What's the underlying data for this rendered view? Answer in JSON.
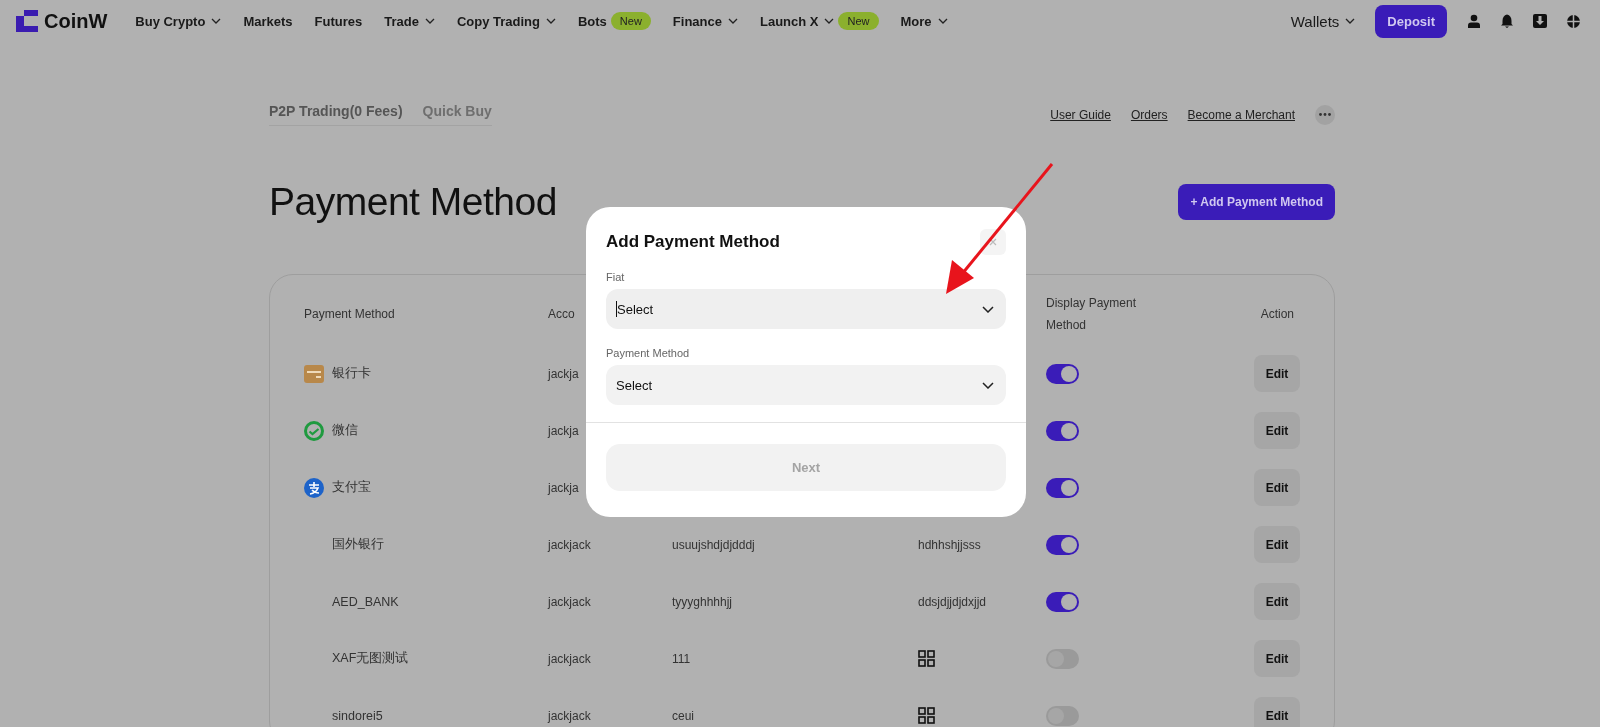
{
  "nav": {
    "logo": "CoinW",
    "items": [
      {
        "label": "Buy Crypto",
        "caret": true
      },
      {
        "label": "Markets",
        "caret": false
      },
      {
        "label": "Futures",
        "caret": false
      },
      {
        "label": "Trade",
        "caret": true
      },
      {
        "label": "Copy Trading",
        "caret": true
      },
      {
        "label": "Bots",
        "caret": false,
        "badge": "New"
      },
      {
        "label": "Finance",
        "caret": true
      },
      {
        "label": "Launch X",
        "caret": true,
        "badge": "New"
      },
      {
        "label": "More",
        "caret": true
      }
    ],
    "wallets": "Wallets",
    "deposit": "Deposit"
  },
  "subnav": {
    "tabs": [
      {
        "label": "P2P Trading(0 Fees)",
        "selected": true
      },
      {
        "label": "Quick Buy",
        "selected": false
      }
    ],
    "links": [
      "User Guide",
      "Orders",
      "Become a Merchant"
    ]
  },
  "page_title": "Payment Method",
  "add_button": "+ Add Payment Method",
  "table": {
    "columns": [
      "Payment Method",
      "Acco",
      "",
      "",
      "Display Payment Method",
      "Action"
    ],
    "rows": [
      {
        "method": "银行卡",
        "account": "jackja",
        "column_3": "",
        "column_4": {
          "kind": "hidden"
        },
        "on": true,
        "action": "Edit"
      },
      {
        "method": "微信",
        "account": "jackja",
        "column_3": "",
        "column_4": {
          "kind": "hidden"
        },
        "on": true,
        "action": "Edit"
      },
      {
        "method": "支付宝",
        "account": "jackja",
        "column_3": "",
        "column_4": {
          "kind": "hidden"
        },
        "on": true,
        "action": "Edit"
      },
      {
        "method": "国外银行",
        "account": "jackjack",
        "column_3": "usuujshdjdjdddj",
        "column_4": {
          "kind": "text",
          "text": "hdhhshjjsss"
        },
        "on": true,
        "action": "Edit"
      },
      {
        "method": "AED_BANK",
        "account": "jackjack",
        "column_3": "tyyyghhhhjj",
        "column_4": {
          "kind": "text",
          "text": "ddsjdjjdjdxjjd"
        },
        "on": true,
        "action": "Edit"
      },
      {
        "method": "XAF无图测试",
        "account": "jackjack",
        "column_3": "111",
        "column_4": {
          "kind": "qr"
        },
        "on": false,
        "action": "Edit"
      },
      {
        "method": "sindorei5",
        "account": "jackjack",
        "column_3": "ceui",
        "column_4": {
          "kind": "qr"
        },
        "on": false,
        "action": "Edit"
      }
    ]
  },
  "modal": {
    "title": "Add Payment Method",
    "fields": [
      {
        "label": "Fiat",
        "placeholder": "Select",
        "focused": true
      },
      {
        "label": "Payment Method",
        "placeholder": "Select",
        "focused": false
      }
    ],
    "next": "Next",
    "next_disabled": true
  }
}
